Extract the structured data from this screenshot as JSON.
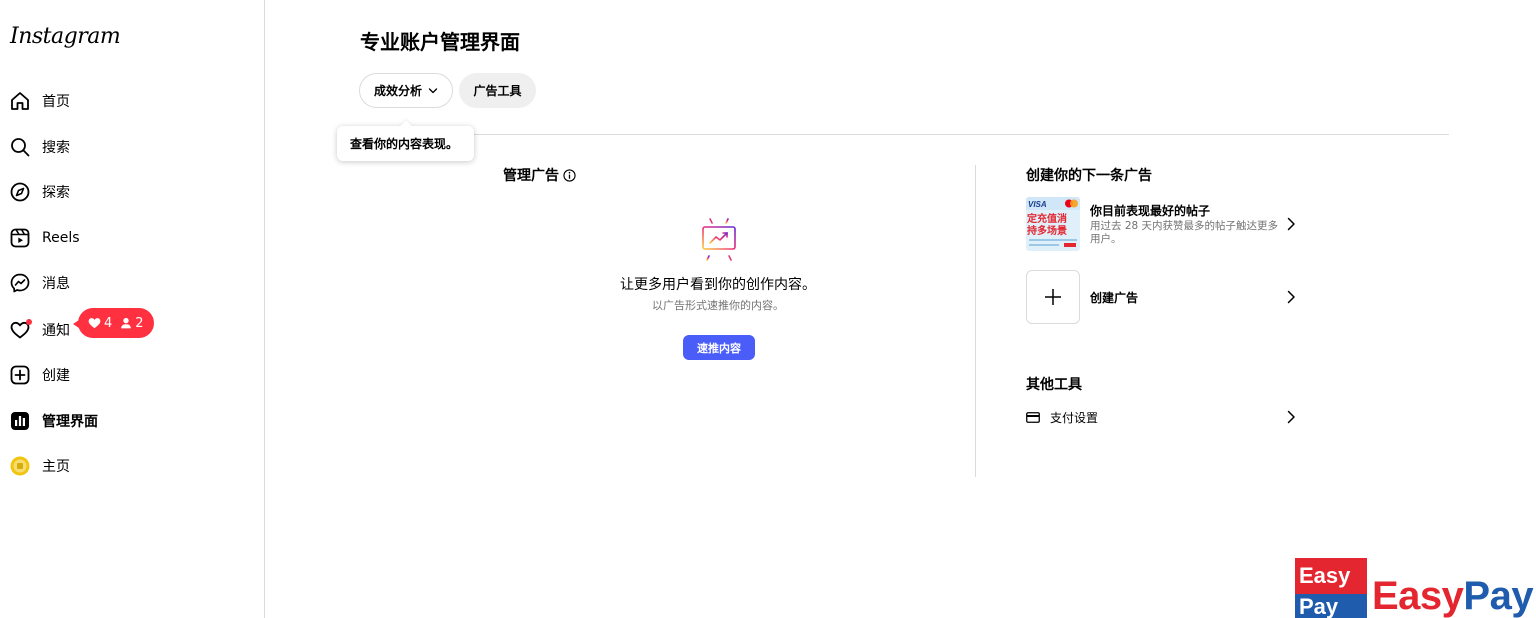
{
  "app": {
    "logo": "Instagram"
  },
  "sidebar": {
    "items": [
      {
        "label": "首页",
        "icon": "home-icon"
      },
      {
        "label": "搜索",
        "icon": "search-icon"
      },
      {
        "label": "探索",
        "icon": "compass-icon"
      },
      {
        "label": "Reels",
        "icon": "reels-icon"
      },
      {
        "label": "消息",
        "icon": "messenger-icon"
      },
      {
        "label": "通知",
        "icon": "heart-icon"
      },
      {
        "label": "创建",
        "icon": "plus-square-icon"
      },
      {
        "label": "管理界面",
        "icon": "dashboard-icon",
        "active": true
      },
      {
        "label": "主页",
        "icon": "avatar"
      }
    ],
    "notification_badge": {
      "likes": "4",
      "follows": "2",
      "color": "#ff3040"
    }
  },
  "main": {
    "title": "专业账户管理界面",
    "tabs": {
      "analytics": "成效分析",
      "ad_tools": "广告工具"
    },
    "tooltip": "查看你的内容表现。",
    "manage_ads": {
      "title": "管理广告",
      "headline": "让更多用户看到你的创作内容。",
      "subtext": "以广告形式速推你的内容。",
      "button": "速推内容",
      "button_color": "#4a5df9"
    },
    "next_ad": {
      "title": "创建你的下一条广告",
      "best_post": {
        "title": "你目前表现最好的帖子",
        "desc": "用过去 28 天内获赞最多的帖子触达更多用户。",
        "thumb_lines": [
          "VISA",
          "定充值消",
          "持多场景"
        ]
      },
      "create_ad": {
        "label": "创建广告"
      }
    },
    "other_tools": {
      "title": "其他工具",
      "payment": {
        "label": "支付设置",
        "icon": "card-icon"
      }
    }
  },
  "watermark": {
    "box_top": "Easy",
    "box_bottom": "Pay",
    "text_a": "Easy",
    "text_b": "Pay"
  }
}
